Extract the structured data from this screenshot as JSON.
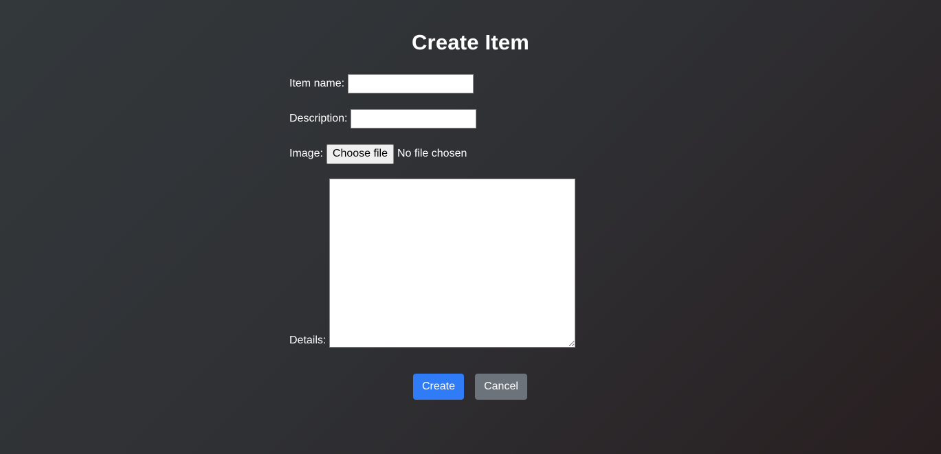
{
  "page": {
    "title": "Create Item"
  },
  "form": {
    "item_name": {
      "label": "Item name:",
      "value": ""
    },
    "description": {
      "label": "Description:",
      "value": ""
    },
    "image": {
      "label": "Image:",
      "button_label": "Choose file",
      "status": "No file chosen"
    },
    "details": {
      "label": "Details:",
      "value": ""
    }
  },
  "actions": {
    "create_label": "Create",
    "cancel_label": "Cancel"
  },
  "colors": {
    "primary": "#2f7cf6",
    "secondary": "#6c737a",
    "background_start": "#33383b",
    "background_end": "#281f20"
  }
}
